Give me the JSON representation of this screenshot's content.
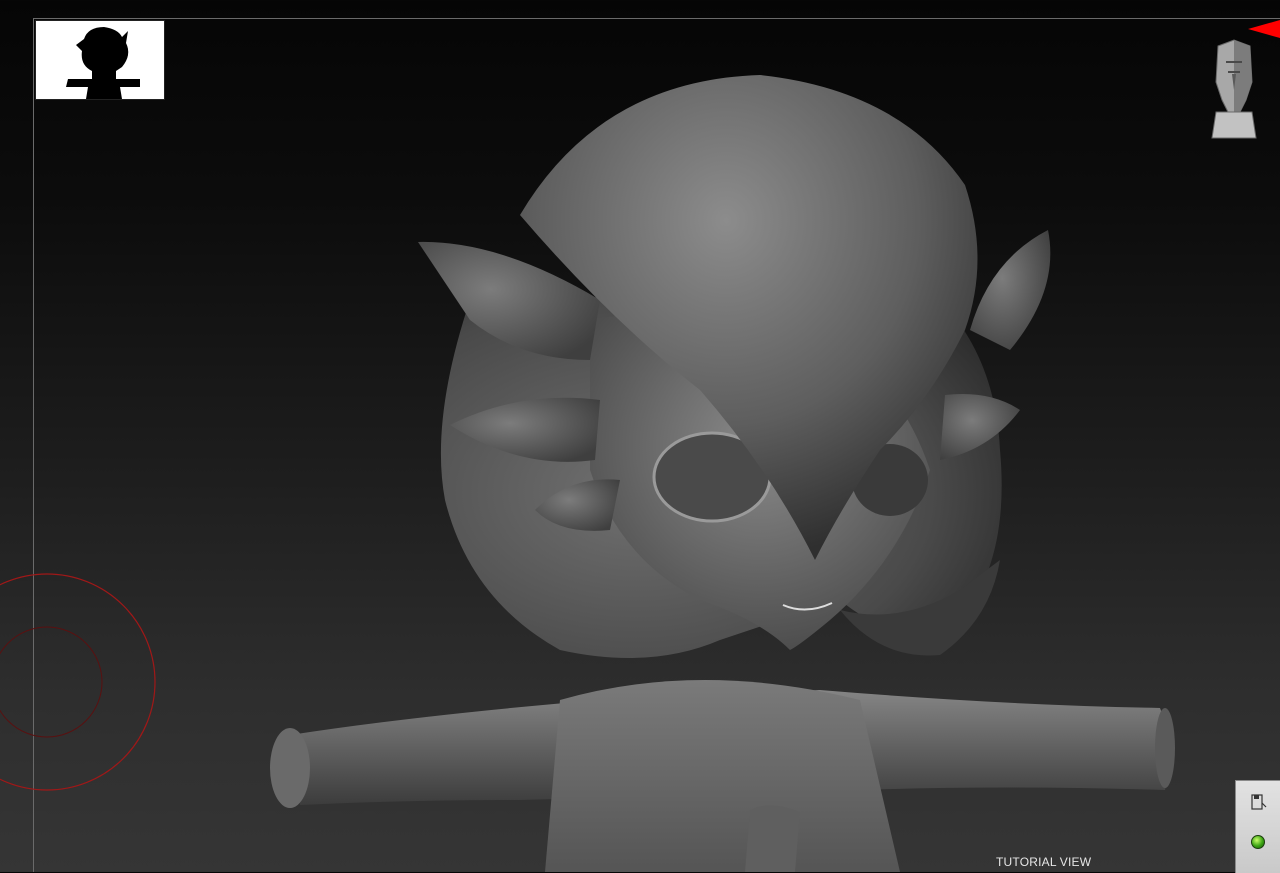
{
  "viewport": {
    "tutorial_label": "TUTORIAL VIEW"
  },
  "icons": {
    "thumbnail": "character-silhouette-thumbnail",
    "navigation": "head-navigation-cube-icon",
    "marker": "red-triangle-marker",
    "brush": "brush-cursor-rings",
    "tray_top": "floppy-save-icon",
    "tray_bottom": "green-status-dot-icon"
  },
  "colors": {
    "accent_red": "#ff0000",
    "brush_ring": "#a01818",
    "status_green": "#3ba314"
  }
}
